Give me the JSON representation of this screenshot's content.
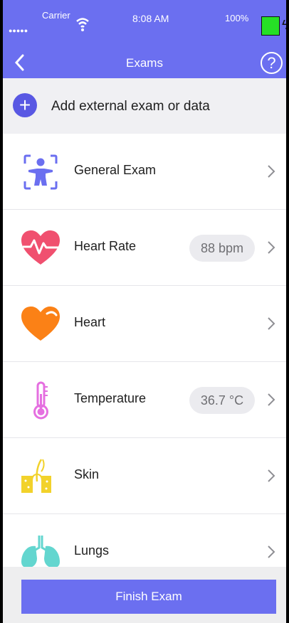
{
  "status_bar": {
    "signal": "●●●●●",
    "carrier": "Carrier",
    "time": "8:08 AM",
    "battery": "100%"
  },
  "header": {
    "title": "Exams",
    "back_icon": "chevron-left-icon",
    "help_label": "?"
  },
  "add_exam": {
    "icon": "plus-circle-icon",
    "label": "Add external exam or data"
  },
  "exams": [
    {
      "icon": "body-scan-icon",
      "label": "General Exam",
      "value": ""
    },
    {
      "icon": "heart-rate-icon",
      "label": "Heart Rate",
      "value": "88 bpm"
    },
    {
      "icon": "heart-icon",
      "label": "Heart",
      "value": ""
    },
    {
      "icon": "thermometer-icon",
      "label": "Temperature",
      "value": "36.7 °C"
    },
    {
      "icon": "skin-icon",
      "label": "Skin",
      "value": ""
    },
    {
      "icon": "lungs-icon",
      "label": "Lungs",
      "value": ""
    }
  ],
  "footer": {
    "finish_label": "Finish Exam"
  },
  "colors": {
    "accent": "#6b6ff0",
    "heart_rate": "#f0506f",
    "heart": "#fb8116",
    "temperature": "#e56fe0",
    "skin": "#f2d22b",
    "lungs": "#63d6cf"
  }
}
